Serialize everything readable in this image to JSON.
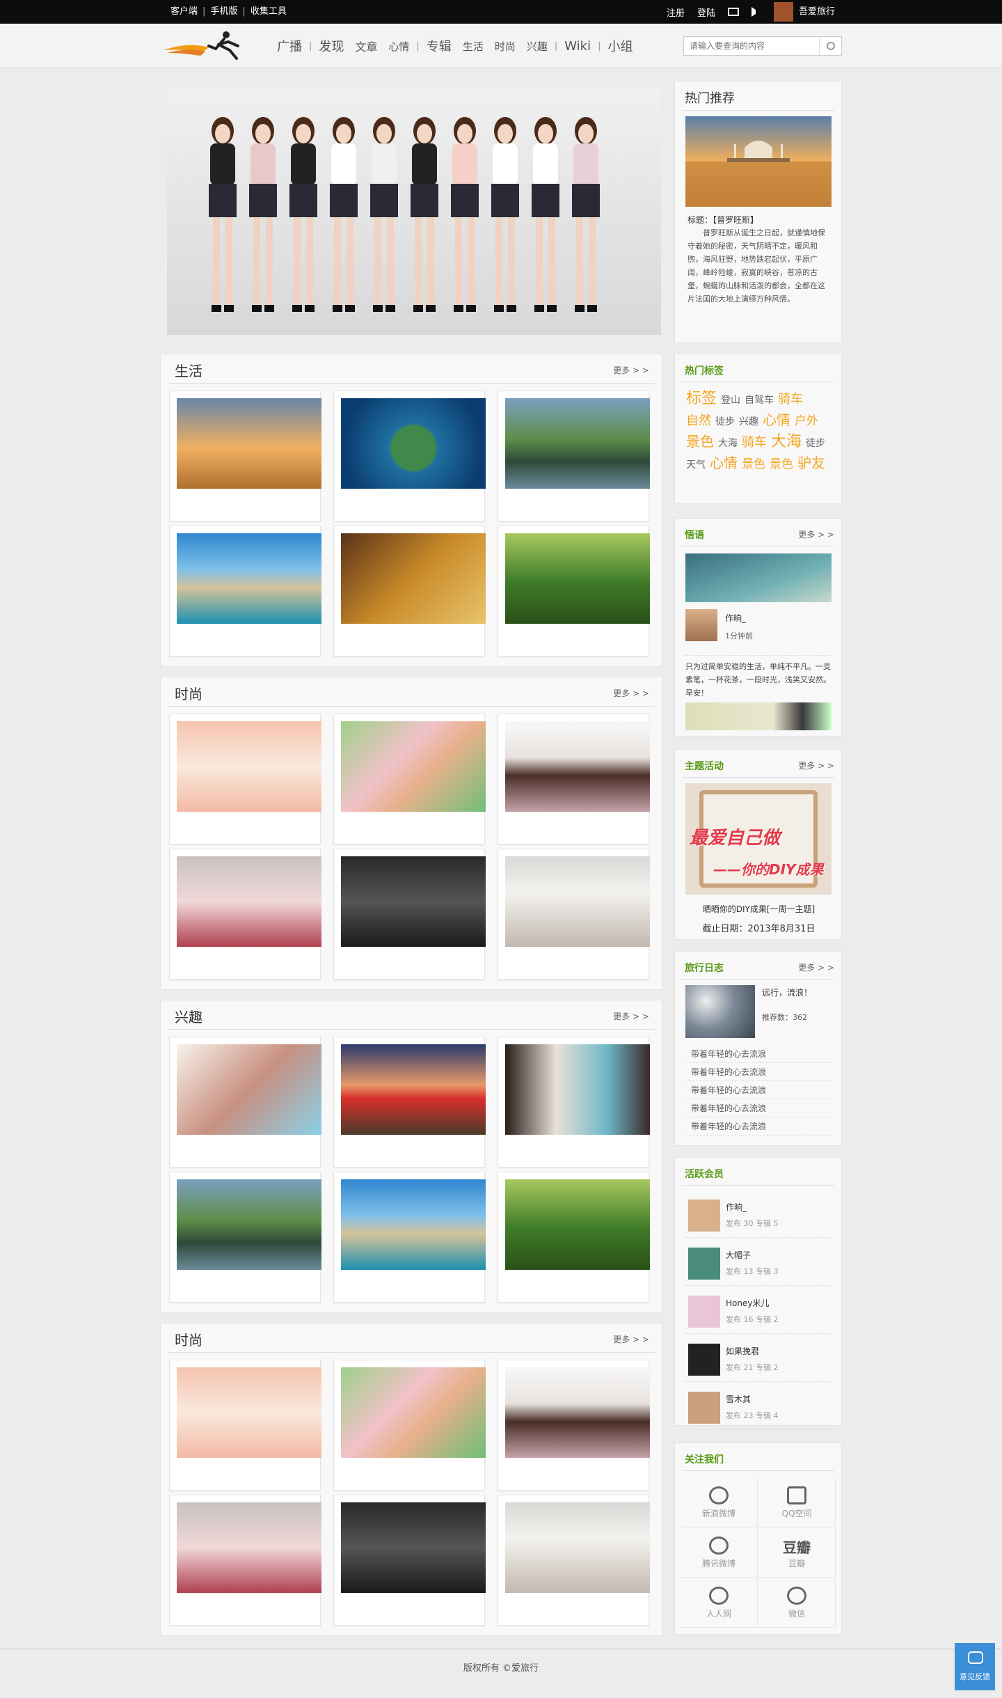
{
  "topbar": {
    "links": [
      "客户端",
      "手机版",
      "收集工具"
    ],
    "register": "注册",
    "login": "登陆",
    "username": "吾爱旅行"
  },
  "nav": {
    "items": [
      "广播",
      "发现",
      "文章",
      "心情",
      "专辑",
      "生活",
      "时尚",
      "兴趣",
      "Wiki",
      "小组"
    ],
    "search_placeholder": "请输入要查询的内容"
  },
  "sections": [
    {
      "title": "生活",
      "more": "更多 > >"
    },
    {
      "title": "时尚",
      "more": "更多 > >"
    },
    {
      "title": "兴趣",
      "more": "更多 > >"
    },
    {
      "title": "时尚",
      "more": "更多 > >"
    }
  ],
  "sidebar": {
    "hot": {
      "title": "热门推荐",
      "caption_title": "标题：【普罗旺斯】",
      "caption_text": "普罗旺斯从诞生之日起，就谨慎地保守着她的秘密，天气阴晴不定，暖风和煦，海风狂野，地势跌宕起伏，平原广阔，峰岭险峻，寂寞的峡谷，苍凉的古堡，蜿蜒的山脉和活泼的都会，全都在这片法国的大地上演绎万种风情。"
    },
    "tags": {
      "title": "热门标签",
      "items": [
        "标签",
        "登山",
        "自驾车",
        "骑车",
        "自然",
        "徒步",
        "兴趣",
        "心情",
        "户外",
        "景色",
        "大海",
        "骑车",
        "大海",
        "徒步",
        "天气",
        "心情",
        "景色",
        "景色",
        "驴友"
      ]
    },
    "quote": {
      "title": "悟语",
      "more": "更多 > >",
      "author": "作晌_",
      "time": "1分钟前",
      "text": "只为过简单安稳的生活，单纯不平凡。一支素笔，一杯花茶，一段时光，浅笑又安然。早安！"
    },
    "event": {
      "title": "主题活动",
      "more": "更多 > >",
      "poster_line1": "最爱自己做",
      "poster_line2": "——你的DIY成果",
      "name": "晒晒你的DIY成果[一周一主题]",
      "deadline": "截止日期：2013年8月31日"
    },
    "log": {
      "title": "旅行日志",
      "more": "更多 > >",
      "feature": "远行，流浪！",
      "recommend": "推荐数：362",
      "items": [
        "带着年轻的心去流浪",
        "带着年轻的心去流浪",
        "带着年轻的心去流浪",
        "带着年轻的心去流浪",
        "带着年轻的心去流浪"
      ]
    },
    "members": {
      "title": "活跃会员",
      "items": [
        {
          "name": "作晌_",
          "stats": "发布 30  专辑 5"
        },
        {
          "name": "大帽子",
          "stats": "发布 13  专辑 3"
        },
        {
          "name": "Honey米儿",
          "stats": "发布 16  专辑 2"
        },
        {
          "name": "如果挽君",
          "stats": "发布 21  专辑 2"
        },
        {
          "name": "雪木其",
          "stats": "发布 23  专辑 4"
        }
      ]
    },
    "follow": {
      "title": "关注我们",
      "items": [
        "新浪微博",
        "QQ空间",
        "腾讯微博",
        "豆瓣",
        "人人网",
        "微信"
      ],
      "douban_logo": "豆瓣"
    }
  },
  "footer": {
    "text": "版权所有 ©爱旅行"
  },
  "feedback": {
    "label": "意见反馈"
  }
}
